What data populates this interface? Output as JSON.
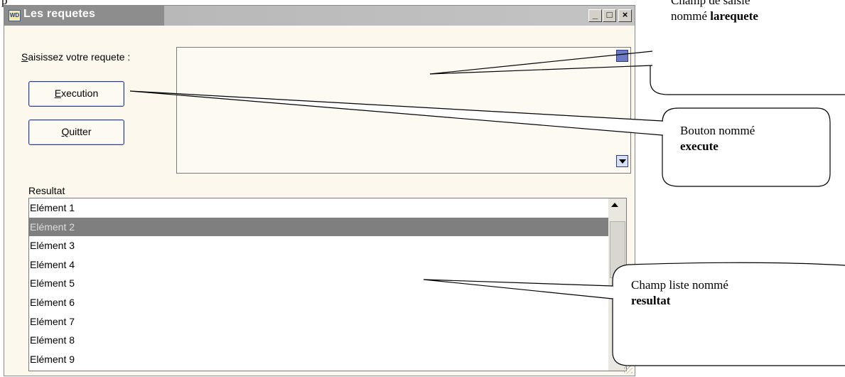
{
  "document": {
    "fragment": "p"
  },
  "window": {
    "icon_text": "WD",
    "title": "Les requetes",
    "min_glyph": "_",
    "max_glyph": "□",
    "close_glyph": "×"
  },
  "form": {
    "requete_label_mnemonic": "S",
    "requete_label_rest": "aisissez votre requete :",
    "execution_mnemonic": "E",
    "execution_rest": "xecution",
    "quitter_mnemonic": "Q",
    "quitter_rest": "uitter",
    "resultat_label": "Resultat"
  },
  "list": {
    "items": [
      "Elément 1",
      "Elément 2",
      "Elément 3",
      "Elément 4",
      "Elément 5",
      "Elément 6",
      "Elément 7",
      "Elément 8",
      "Elément 9"
    ],
    "selected_index": 1
  },
  "callouts": {
    "larequete_line1": "Champ de saisie",
    "larequete_prefix": "nommé ",
    "larequete_name": "larequete",
    "execute_line1": "Bouton nommé",
    "execute_name": "execute",
    "resultat_line1": "Champ liste nommé",
    "resultat_name": "resultat"
  }
}
